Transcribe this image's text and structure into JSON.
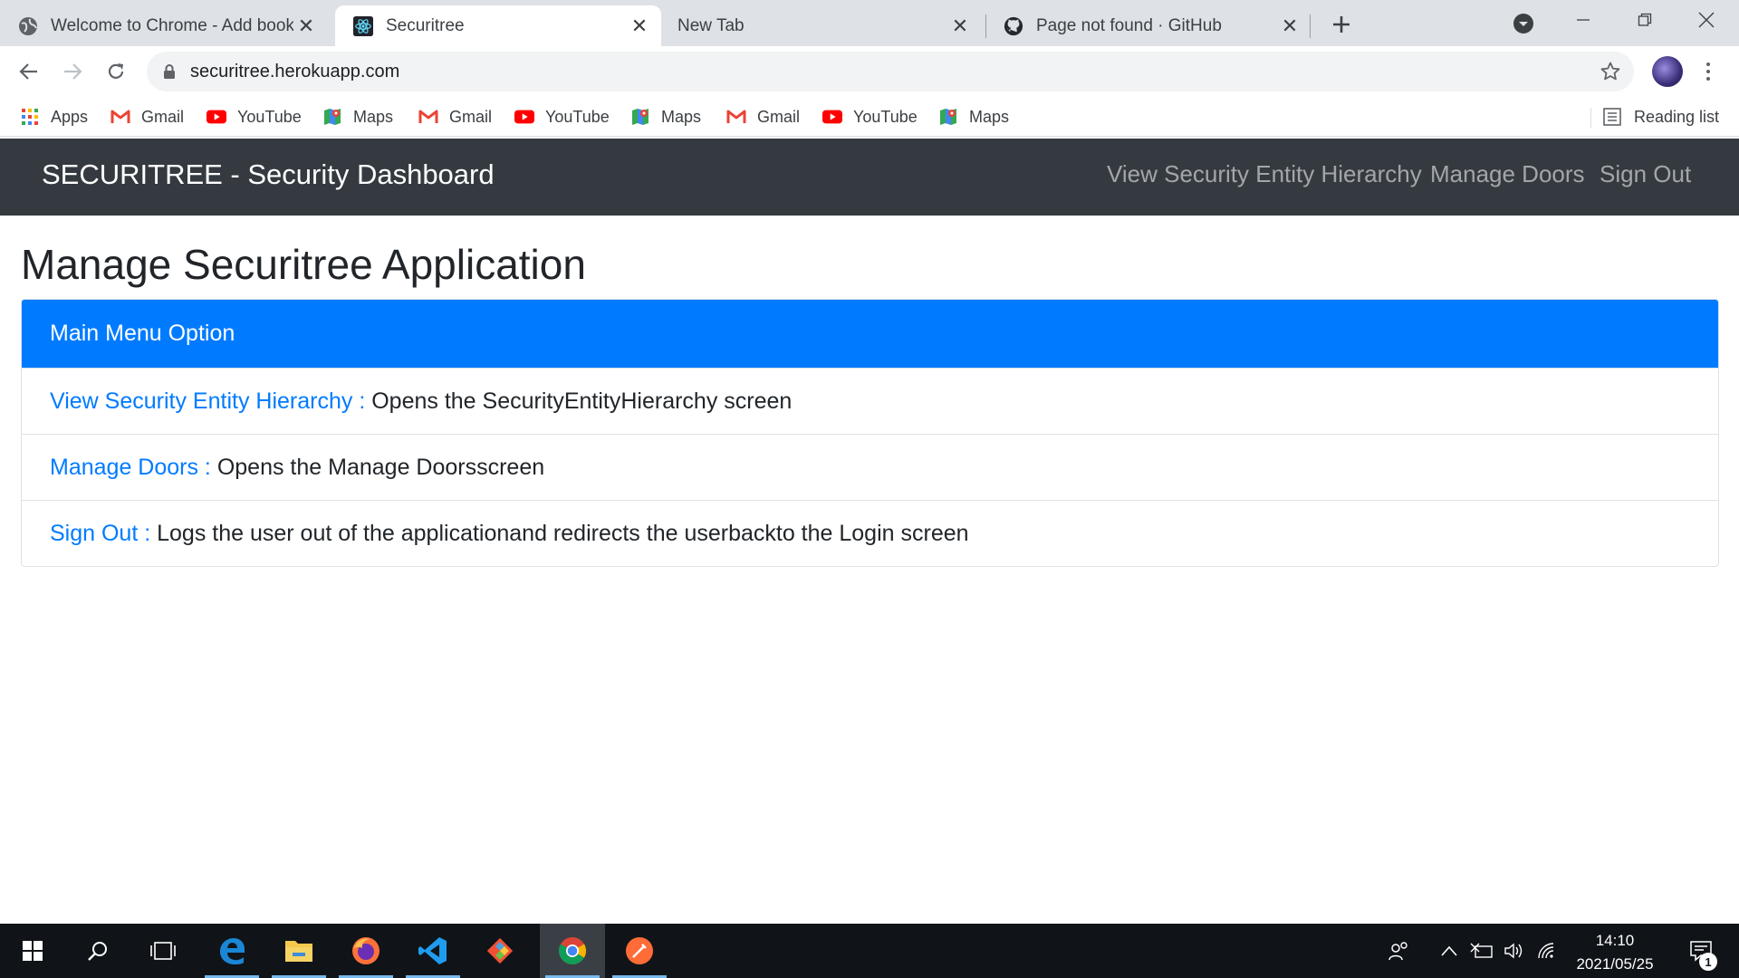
{
  "browser": {
    "tabs": [
      {
        "title": "Welcome to Chrome - Add book",
        "icon": "globe-icon",
        "active": false
      },
      {
        "title": "Securitree",
        "icon": "react-icon",
        "active": true
      },
      {
        "title": "New Tab",
        "icon": "",
        "active": false
      },
      {
        "title": "Page not found · GitHub",
        "icon": "github-icon",
        "active": false
      }
    ],
    "url": "securitree.herokuapp.com",
    "bookmarks": [
      {
        "label": "Apps",
        "icon": "apps-grid-icon"
      },
      {
        "label": "Gmail",
        "icon": "gmail-icon"
      },
      {
        "label": "YouTube",
        "icon": "youtube-icon"
      },
      {
        "label": "Maps",
        "icon": "maps-icon"
      },
      {
        "label": "Gmail",
        "icon": "gmail-icon"
      },
      {
        "label": "YouTube",
        "icon": "youtube-icon"
      },
      {
        "label": "Maps",
        "icon": "maps-icon"
      },
      {
        "label": "Gmail",
        "icon": "gmail-icon"
      },
      {
        "label": "YouTube",
        "icon": "youtube-icon"
      },
      {
        "label": "Maps",
        "icon": "maps-icon"
      }
    ],
    "reading_list": "Reading list"
  },
  "navbar": {
    "brand": "SECURITREE - Security Dashboard",
    "links": [
      "View Security Entity Hierarchy",
      "Manage Doors",
      "Sign Out"
    ]
  },
  "main": {
    "heading": "Manage Securitree Application",
    "card_header": "Main Menu Option",
    "items": [
      {
        "link": "View Security Entity Hierarchy :",
        "description": " Opens the SecurityEntityHierarchy screen"
      },
      {
        "link": "Manage Doors :",
        "description": " Opens the Manage Doorsscreen"
      },
      {
        "link": "Sign Out :",
        "description": " Logs the user out of the applicationand redirects the userbackto the Login screen"
      }
    ]
  },
  "taskbar": {
    "apps": [
      "windows-start-icon",
      "search-icon",
      "task-view-icon",
      "edge-icon",
      "file-explorer-icon",
      "firefox-icon",
      "vscode-icon",
      "git-icon",
      "chrome-icon",
      "postman-icon"
    ],
    "time": "14:10",
    "date": "2021/05/25",
    "notification_count": "1"
  },
  "colors": {
    "navbar_bg": "#343a40",
    "primary": "#007bff",
    "tabstrip_bg": "#dee1e6"
  }
}
